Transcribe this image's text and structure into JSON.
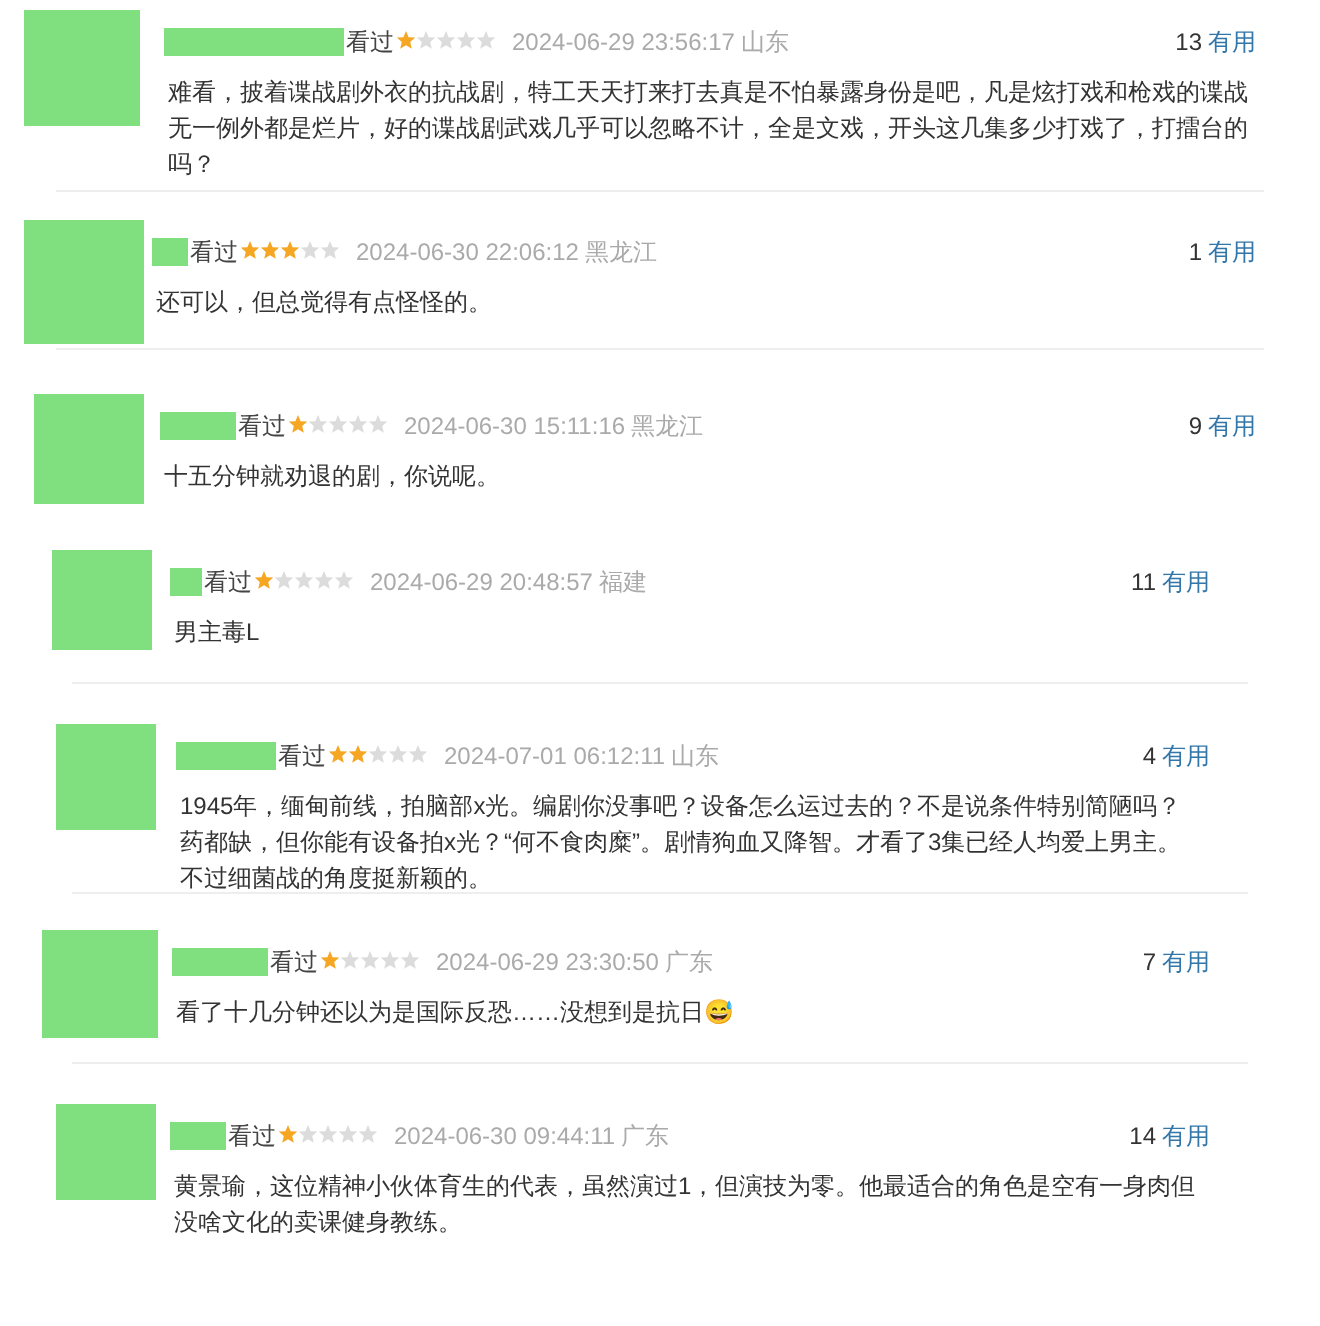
{
  "comments": [
    {
      "status": "看过",
      "stars": 1,
      "time": "2024-06-29 23:56:17",
      "location": "山东",
      "votes": "13",
      "useful": "有用",
      "text": "难看，披着谍战剧外衣的抗战剧，特工天天打来打去真是不怕暴露身份是吧，凡是炫打戏和枪戏的谍战无一例外都是烂片，好的谍战剧武戏几乎可以忽略不计，全是文戏，开头这几集多少打戏了，打擂台的吗？"
    },
    {
      "status": "看过",
      "stars": 3,
      "time": "2024-06-30 22:06:12",
      "location": "黑龙江",
      "votes": "1",
      "useful": "有用",
      "text": "还可以，但总觉得有点怪怪的。"
    },
    {
      "status": "看过",
      "stars": 1,
      "time": "2024-06-30 15:11:16",
      "location": "黑龙江",
      "votes": "9",
      "useful": "有用",
      "text": "十五分钟就劝退的剧，你说呢。"
    },
    {
      "status": "看过",
      "stars": 1,
      "time": "2024-06-29 20:48:57",
      "location": "福建",
      "votes": "11",
      "useful": "有用",
      "text": "男主毒L"
    },
    {
      "status": "看过",
      "stars": 2,
      "time": "2024-07-01 06:12:11",
      "location": "山东",
      "votes": "4",
      "useful": "有用",
      "text": "1945年，缅甸前线，拍脑部x光。编剧你没事吧？设备怎么运过去的？不是说条件特别简陋吗？药都缺，但你能有设备拍x光？“何不食肉糜”。剧情狗血又降智。才看了3集已经人均爱上男主。不过细菌战的角度挺新颖的。"
    },
    {
      "status": "看过",
      "stars": 1,
      "time": "2024-06-29 23:30:50",
      "location": "广东",
      "votes": "7",
      "useful": "有用",
      "text": "看了十几分钟还以为是国际反恐……没想到是抗日😅"
    },
    {
      "status": "看过",
      "stars": 1,
      "time": "2024-06-30 09:44:11",
      "location": "广东",
      "votes": "14",
      "useful": "有用",
      "text": "黄景瑜，这位精神小伙体育生的代表，虽然演过1，但演技为零。他最适合的角色是空有一身肉但没啥文化的卖课健身教练。"
    }
  ]
}
